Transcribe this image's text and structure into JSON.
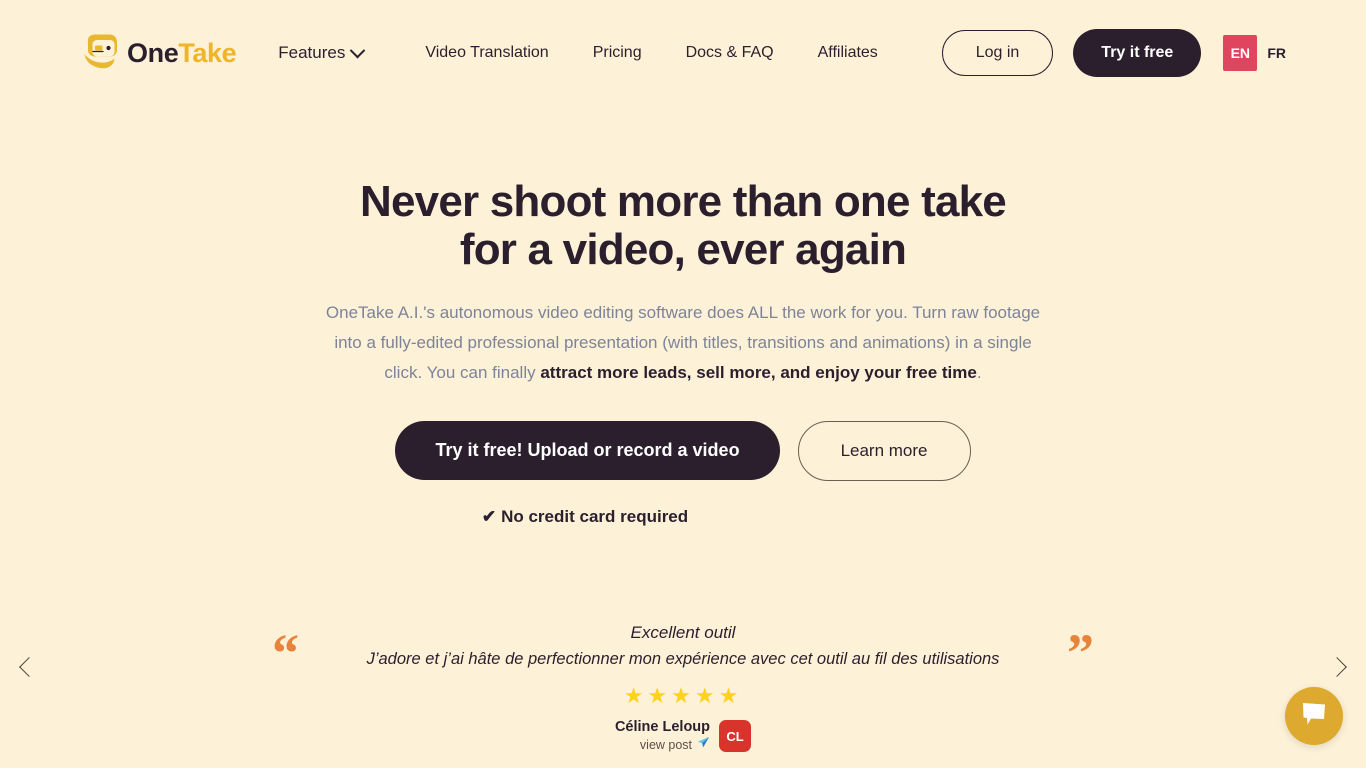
{
  "header": {
    "brand": {
      "name_part1": "One",
      "name_part2": "Take",
      "logo_icon": "onetake-face-logo"
    },
    "features_label": "Features",
    "nav_links": [
      {
        "label": "Video Translation"
      },
      {
        "label": "Pricing"
      },
      {
        "label": "Docs & FAQ"
      },
      {
        "label": "Affiliates"
      }
    ],
    "login_label": "Log in",
    "try_free_label": "Try it free",
    "lang_active": "EN",
    "lang_other": "FR",
    "lang_active_color": "#E0455F"
  },
  "hero": {
    "heading": "Never shoot more than one take for a video, ever again",
    "sub_line1": "OneTake A.I.'s autonomous video editing software does ALL the work for you.",
    "sub_line2": "Turn raw footage into a fully-edited professional presentation (with titles, transitions and animations) in a single click.",
    "sub_line3_prefix": "You can finally ",
    "sub_line3_bold": "attract more leads, sell more, and enjoy your free time",
    "sub_line3_suffix": ".",
    "cta_primary": "Try it free! Upload or record a video",
    "cta_secondary": "Learn more",
    "no_card_tick": "✔",
    "no_card_label": "No credit card required"
  },
  "testimonial": {
    "title": "Excellent outil",
    "text": "J’adore et j’ai hâte de perfectionner mon expérience avec cet outil au fil des utilisations",
    "stars": "★★★★★",
    "rating": 5,
    "author_name": "Céline Leloup",
    "view_post_label": "view post",
    "view_post_icon": "paper-plane-icon",
    "avatar_initials": "CL",
    "avatar_color": "#D9342B",
    "quote_open": "“",
    "quote_close": "”",
    "quote_color": "#E8833A"
  },
  "widgets": {
    "chat_icon": "chat-bubble-icon",
    "chat_color": "#DDA92E"
  }
}
